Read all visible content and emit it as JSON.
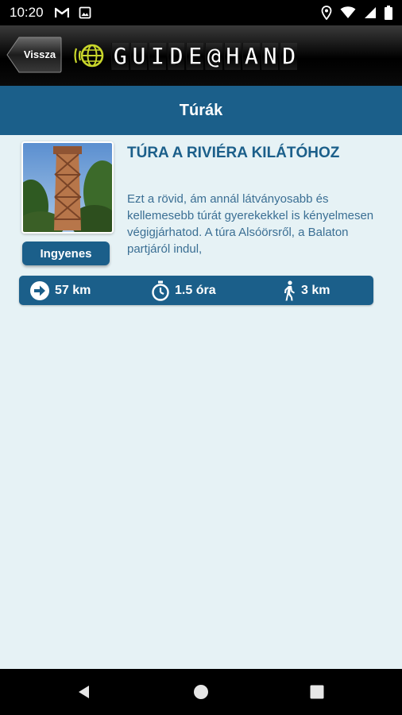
{
  "status_bar": {
    "time": "10:20",
    "left_icons": [
      "gmail-icon",
      "image-icon"
    ],
    "right_icons": [
      "location-icon",
      "wifi-icon",
      "signal-icon",
      "battery-icon"
    ]
  },
  "header": {
    "back_label": "Vissza",
    "logo_text": "GUIDE@HAND"
  },
  "page_title": "Túrák",
  "tour": {
    "title": "TÚRA A RIVIÉRA KILÁTÓHOZ",
    "description": "Ezt a rövid, ám annál látványosabb és kellemesebb túrát gyerekekkel is kényelmesen végigjárhatod. A túra Alsóörsről, a Balaton partjáról indul,",
    "price": "Ingyenes",
    "stats": {
      "distance": "57 km",
      "duration": "1.5 óra",
      "walking": "3 km"
    }
  },
  "colors": {
    "primary": "#1b5f8a",
    "background": "#e6f2f5",
    "text_blue": "#3b6f94",
    "logo_globe": "#c8d62b"
  },
  "nav_bar": {
    "icons": [
      "back-triangle-icon",
      "home-circle-icon",
      "recents-square-icon"
    ]
  }
}
